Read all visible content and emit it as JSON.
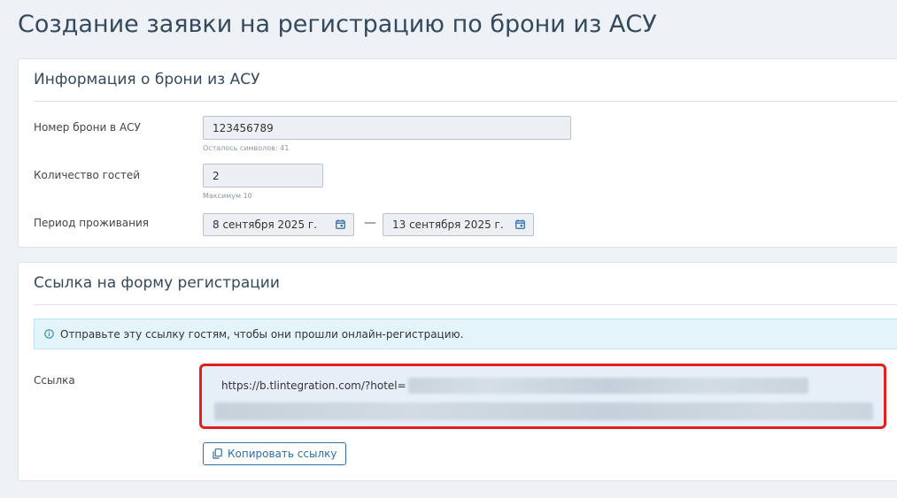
{
  "page": {
    "title": "Создание заявки на регистрацию по брони из АСУ"
  },
  "booking_panel": {
    "title": "Информация о брони из АСУ",
    "booking_number": {
      "label": "Номер брони в АСУ",
      "value": "123456789",
      "hint": "Осталось символов: 41"
    },
    "guests": {
      "label": "Количество гостей",
      "value": "2",
      "hint": "Максимум 10"
    },
    "period": {
      "label": "Период проживания",
      "from": "8 сентября 2025 г.",
      "separator": "—",
      "to": "13 сентября 2025 г."
    }
  },
  "link_panel": {
    "title": "Ссылка на форму регистрации",
    "info_text": "Отправьте эту ссылку гостям, чтобы они прошли онлайн-регистрацию.",
    "link_label": "Ссылка",
    "link_visible_text": "https://b.tlintegration.com/?hotel=",
    "copy_button_label": "Копировать ссылку"
  },
  "icons": {
    "calendar": "calendar-icon",
    "info": "info-icon",
    "copy": "copy-icon"
  },
  "colors": {
    "accent": "#2f6ea8",
    "highlight_border": "#e02020",
    "alert_bg": "#e3f4fb"
  }
}
